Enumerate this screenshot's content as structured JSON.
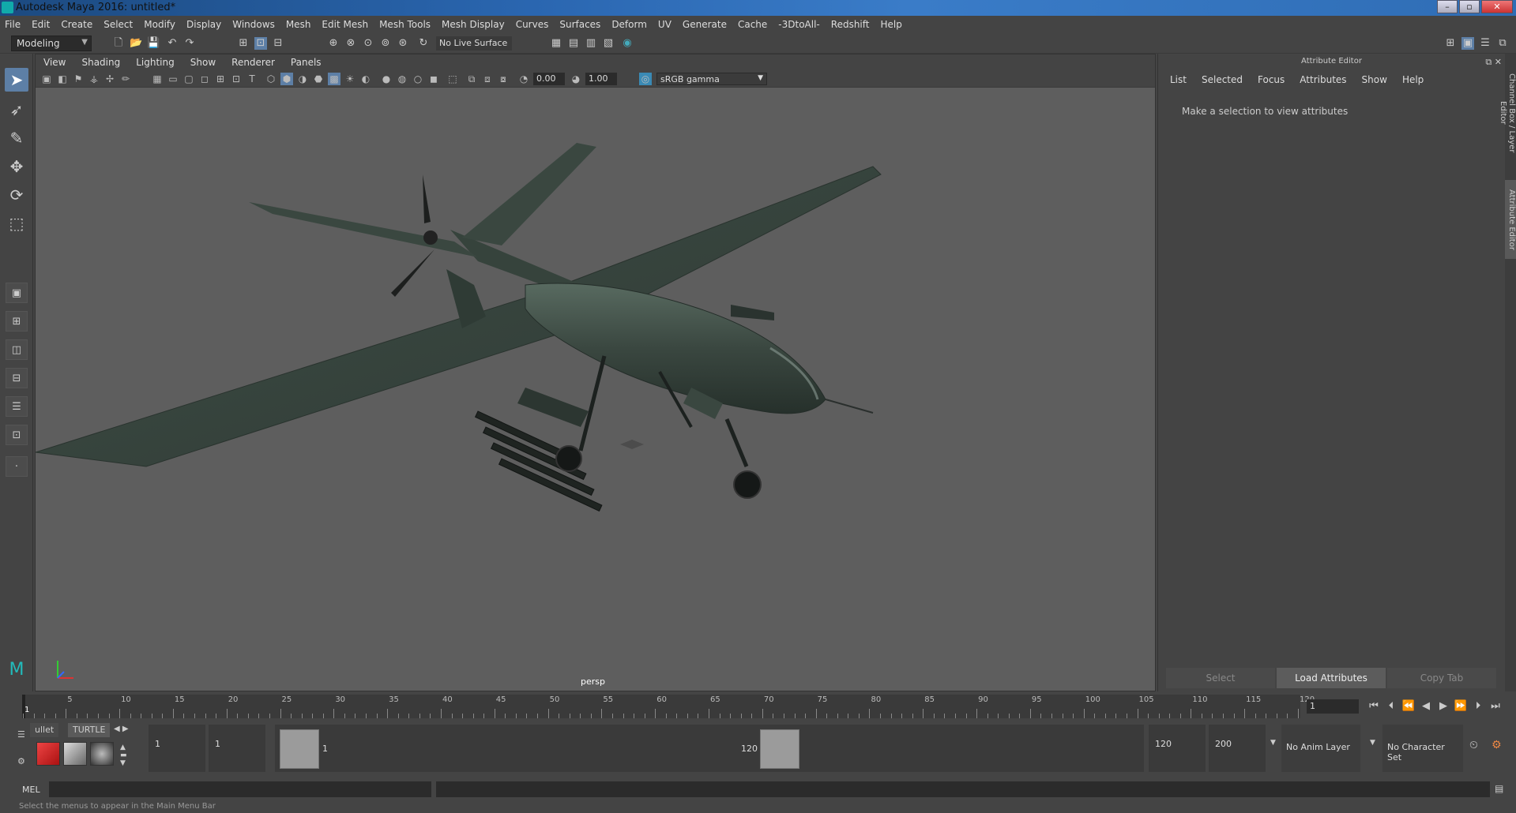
{
  "window": {
    "title": "Autodesk Maya 2016: untitled*",
    "buttons": [
      "–",
      "▫",
      "✕"
    ]
  },
  "menubar": [
    "File",
    "Edit",
    "Create",
    "Select",
    "Modify",
    "Display",
    "Windows",
    "Mesh",
    "Edit Mesh",
    "Mesh Tools",
    "Mesh Display",
    "Curves",
    "Surfaces",
    "Deform",
    "UV",
    "Generate",
    "Cache",
    "-3DtoAll-",
    "Redshift",
    "Help"
  ],
  "statusline": {
    "mode": "Modeling",
    "live_surface": "No Live Surface"
  },
  "viewport": {
    "menu": [
      "View",
      "Shading",
      "Lighting",
      "Show",
      "Renderer",
      "Panels"
    ],
    "exposure": "0.00",
    "gamma_value": "1.00",
    "color_space": "sRGB gamma",
    "camera": "persp"
  },
  "attribute_editor": {
    "title": "Attribute Editor",
    "menu": [
      "List",
      "Selected",
      "Focus",
      "Attributes",
      "Show",
      "Help"
    ],
    "message": "Make a selection to view attributes",
    "buttons": [
      "Select",
      "Load Attributes",
      "Copy Tab"
    ]
  },
  "side_tabs": [
    "Channel Box / Layer Editor",
    "Attribute Editor"
  ],
  "timeline": {
    "ticks": [
      "1",
      "5",
      "10",
      "15",
      "20",
      "25",
      "30",
      "35",
      "40",
      "45",
      "50",
      "55",
      "60",
      "65",
      "70",
      "75",
      "80",
      "85",
      "90",
      "95",
      "100",
      "105",
      "110",
      "115",
      "120"
    ],
    "current_frame": "1"
  },
  "shelf": {
    "tabs": [
      "ullet",
      "TURTLE"
    ]
  },
  "range": {
    "start_time": "1",
    "playback_start": "1",
    "range_start_label": "1",
    "range_end_label": "120",
    "playback_end": "120",
    "end_time": "200",
    "anim_layer": "No Anim Layer",
    "character_set": "No Character Set"
  },
  "command": {
    "label": "MEL",
    "help_text": "Select the menus to appear in the Main Menu Bar"
  },
  "colors": {
    "viewport_bg": "#5e5e5e",
    "ui_bg": "#444444",
    "accent": "#5d7fa6",
    "drone": "#3c4a43"
  }
}
